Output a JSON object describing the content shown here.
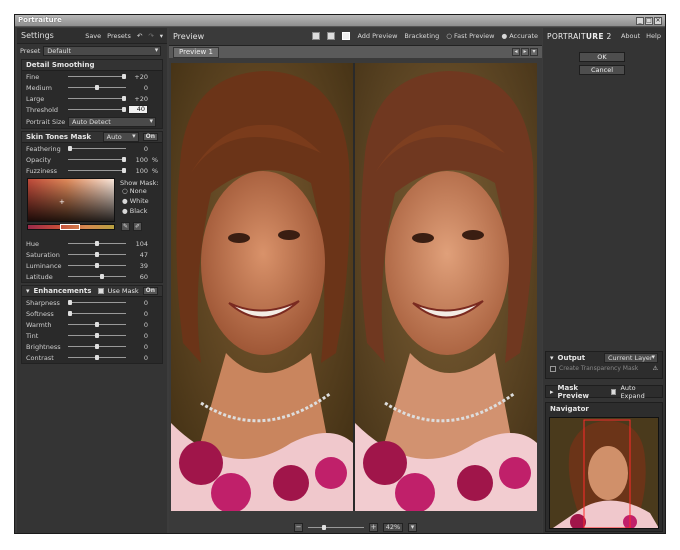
{
  "window": {
    "title": "Portraiture"
  },
  "settings": {
    "title": "Settings",
    "save": "Save",
    "presets": "Presets",
    "preset_label": "Preset",
    "preset_value": "Default"
  },
  "detail": {
    "title": "Detail Smoothing",
    "rows": [
      {
        "label": "Fine",
        "value": "+20",
        "pos": 100
      },
      {
        "label": "Medium",
        "value": "0",
        "pos": 50
      },
      {
        "label": "Large",
        "value": "+20",
        "pos": 100
      },
      {
        "label": "Threshold",
        "value": "40",
        "pos": 100
      }
    ],
    "portrait_size_label": "Portrait Size",
    "portrait_size_value": "Auto Detect"
  },
  "mask": {
    "title": "Skin Tones Mask",
    "mode": "Auto",
    "on": "On",
    "rows": [
      {
        "label": "Feathering",
        "value": "0",
        "unit": "",
        "pos": 0
      },
      {
        "label": "Opacity",
        "value": "100",
        "unit": "%",
        "pos": 100
      },
      {
        "label": "Fuzziness",
        "value": "100",
        "unit": "%",
        "pos": 100
      }
    ],
    "show_mask": "Show Mask:",
    "options": [
      "None",
      "White",
      "Black"
    ],
    "hsl": [
      {
        "label": "Hue",
        "value": "104",
        "pos": 50
      },
      {
        "label": "Saturation",
        "value": "47",
        "pos": 50
      },
      {
        "label": "Luminance",
        "value": "39",
        "pos": 50
      },
      {
        "label": "Latitude",
        "value": "60",
        "pos": 60
      }
    ]
  },
  "enh": {
    "title": "Enhancements",
    "use_mask": "Use Mask",
    "on": "On",
    "rows": [
      {
        "label": "Sharpness",
        "value": "0",
        "pos": 0
      },
      {
        "label": "Softness",
        "value": "0",
        "pos": 0
      },
      {
        "label": "Warmth",
        "value": "0",
        "pos": 50
      },
      {
        "label": "Tint",
        "value": "0",
        "pos": 50
      },
      {
        "label": "Brightness",
        "value": "0",
        "pos": 50
      },
      {
        "label": "Contrast",
        "value": "0",
        "pos": 50
      }
    ]
  },
  "preview": {
    "title": "Preview",
    "add": "Add Preview",
    "bracketing": "Bracketing",
    "fast": "Fast Preview",
    "accurate": "Accurate",
    "tab": "Preview 1",
    "zoom": "42%"
  },
  "right": {
    "brand_1": "PORTRAIT",
    "brand_2": "URE",
    "brand_3": "2",
    "about": "About",
    "help": "Help",
    "ok": "OK",
    "cancel": "Cancel",
    "output_title": "Output",
    "output_value": "Current Layer",
    "transparency": "Create Transparency Mask",
    "mask_preview": "Mask Preview",
    "auto_expand": "Auto Expand",
    "navigator": "Navigator"
  }
}
